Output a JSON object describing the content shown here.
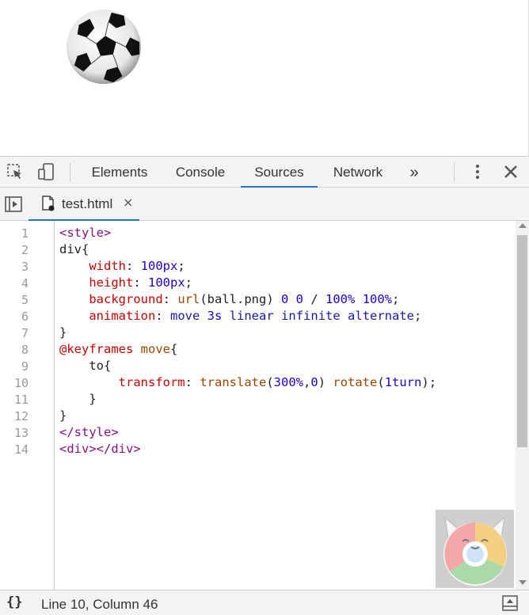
{
  "devtools": {
    "tabs": [
      {
        "label": "Elements"
      },
      {
        "label": "Console"
      },
      {
        "label": "Sources"
      },
      {
        "label": "Network"
      }
    ],
    "more_tabs_glyph": "»",
    "active_tab": "Sources"
  },
  "file_tab": {
    "label": "test.html",
    "close_glyph": "×"
  },
  "editor": {
    "line_numbers": [
      "1",
      "2",
      "3",
      "4",
      "5",
      "6",
      "7",
      "8",
      "9",
      "10",
      "11",
      "12",
      "13",
      "14"
    ],
    "code_lines": [
      "<style>",
      "div{",
      "    width: 100px;",
      "    height: 100px;",
      "    background: url(ball.png) 0 0 / 100% 100%;",
      "    animation: move 3s linear infinite alternate;",
      "}",
      "@keyframes move{",
      "    to{",
      "        transform: translate(300%,0) rotate(1turn);",
      "    }",
      "}",
      "</style>",
      "<div></div>"
    ]
  },
  "status": {
    "pretty_print_glyph": "{}",
    "cursor_position": "Line 10, Column 46"
  },
  "colors": {
    "accent": "#1a73e8",
    "tag": "#881280",
    "property": "#c80000",
    "number": "#1c00cf"
  }
}
